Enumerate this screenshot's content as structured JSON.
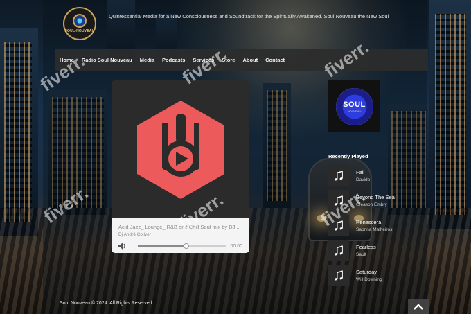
{
  "site": {
    "logo_text": "SOUL-NOUVEAU",
    "tagline": "Quintessential Media for a New Consciousness and Soundtrack for the Spiritually Awakened. Soul Nouveau the New Soul"
  },
  "nav": {
    "items": [
      {
        "label": "Home"
      },
      {
        "label": "Radio Soul Nouveau"
      },
      {
        "label": "Media"
      },
      {
        "label": "Podcasts"
      },
      {
        "label": "Services"
      },
      {
        "label": "Store"
      },
      {
        "label": "About"
      },
      {
        "label": "Contact"
      }
    ]
  },
  "player": {
    "track_title": "Acid Jazz_ Lounge_ R&B and Chill Soul mix by DJ...",
    "artist": "Dj André Collyer",
    "time": "00:00",
    "progress": 0.55,
    "accent_color": "#ec5a5b"
  },
  "sidebar": {
    "logo_word": "SOUL",
    "logo_sub": "NOUVEAU",
    "recent_heading": "Recently Played",
    "recent": [
      {
        "title": "Fall",
        "artist": "Davido"
      },
      {
        "title": "Beyond The Sea",
        "artist": "Gleason Embry"
      },
      {
        "title": "Renascerá",
        "artist": "Sabrina Malheiros"
      },
      {
        "title": "Fearless",
        "artist": "Sault"
      },
      {
        "title": "Saturday",
        "artist": "Will Downing"
      }
    ]
  },
  "footer": {
    "copyright": "Soul Nouveau © 2024. All Rights Reserved."
  },
  "watermark": "fiverr."
}
